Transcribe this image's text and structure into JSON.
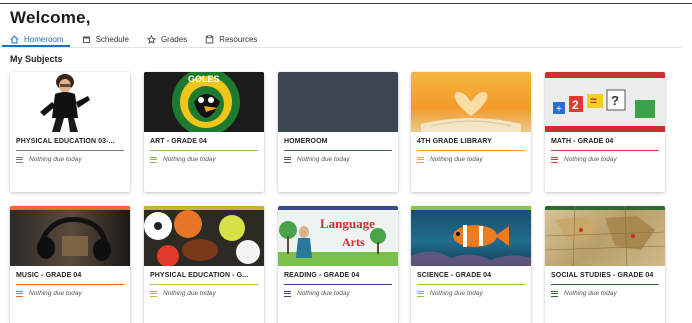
{
  "header": {
    "title": "Welcome,"
  },
  "tabs": [
    {
      "label": "Homeroom",
      "icon": "home-icon",
      "active": true
    },
    {
      "label": "Schedule",
      "icon": "calendar-icon",
      "active": false
    },
    {
      "label": "Grades",
      "icon": "star-icon",
      "active": false
    },
    {
      "label": "Resources",
      "icon": "resources-icon",
      "active": false
    }
  ],
  "section": {
    "title": "My Subjects"
  },
  "colors": {
    "accent": "#1d6fb8"
  },
  "subjects": [
    {
      "title": "PHYSICAL EDUCATION 03-...",
      "due": "Nothing due today",
      "color": "#7a7a7a",
      "image": "teacher-bitmoji-image"
    },
    {
      "title": "ART - GRADE 04",
      "due": "Nothing due today",
      "color": "#7cbf4d",
      "image": "eagles-mascot-logo-image"
    },
    {
      "title": "HOMEROOM",
      "due": "Nothing due today",
      "color": "#4a5763",
      "image": "solid-slate-banner"
    },
    {
      "title": "4TH GRADE LIBRARY",
      "due": "Nothing due today",
      "color": "#f3a03a",
      "image": "book-heart-pages-image"
    },
    {
      "title": "MATH - GRADE 04",
      "due": "Nothing due today",
      "color": "#d93a3a",
      "image": "math-blocks-image"
    },
    {
      "title": "MUSIC - GRADE 04",
      "due": "Nothing due today",
      "color": "#f06a2a",
      "image": "headphones-image"
    },
    {
      "title": "PHYSICAL EDUCATION - G...",
      "due": "Nothing due today",
      "color": "#c7b23a",
      "image": "sports-balls-image"
    },
    {
      "title": "READING - GRADE 04",
      "due": "Nothing due today",
      "color": "#3a4a8a",
      "image": "language-arts-image"
    },
    {
      "title": "SCIENCE - GRADE 04",
      "due": "Nothing due today",
      "color": "#8cc63f",
      "image": "clownfish-image"
    },
    {
      "title": "SOCIAL STUDIES - GRADE 04",
      "due": "Nothing due today",
      "color": "#2e6b2e",
      "image": "world-map-image"
    }
  ],
  "thumb_text": {
    "reading_line1": "Language",
    "reading_line2": "Arts",
    "art_logo": "GOLES ELE...RY",
    "math_symbols": "+2=?"
  }
}
